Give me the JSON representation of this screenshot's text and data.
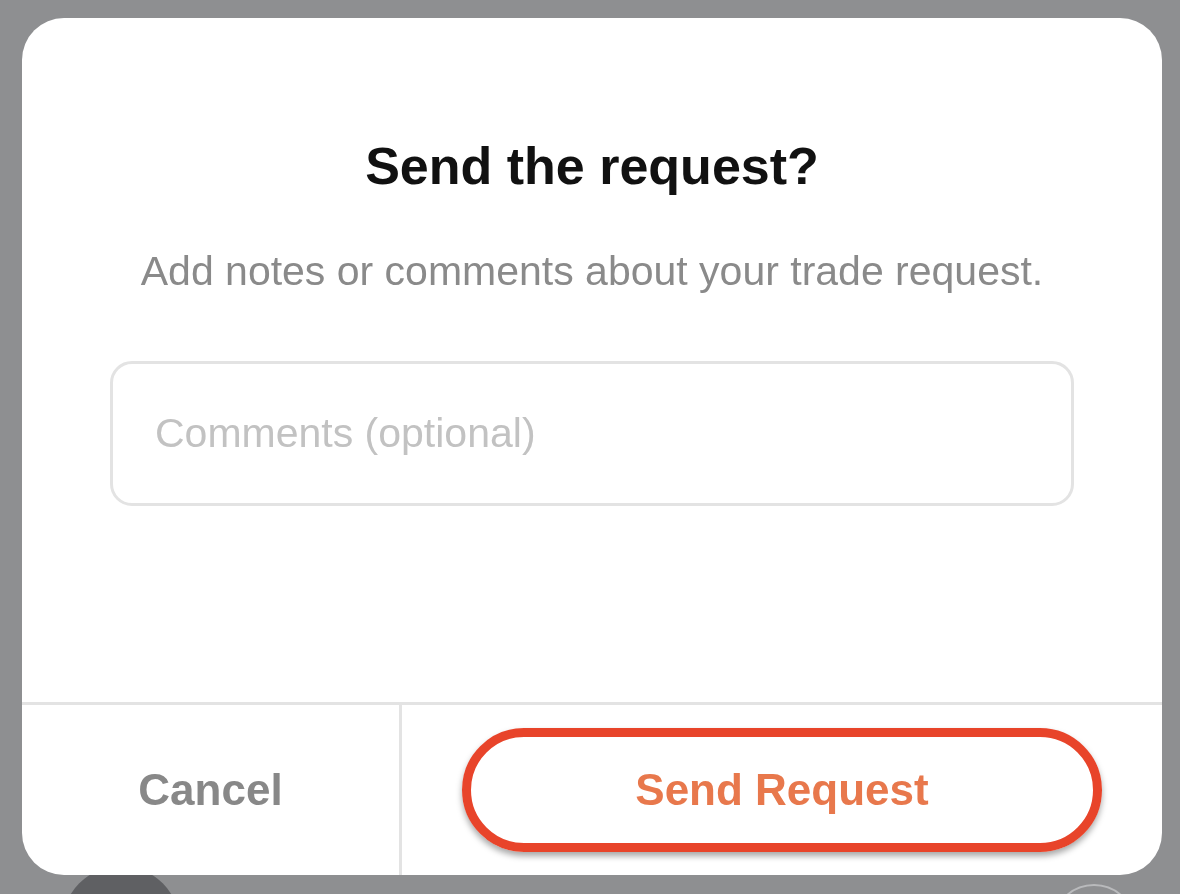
{
  "dialog": {
    "title": "Send the request?",
    "message": "Add notes or comments about your trade request.",
    "comment_field": {
      "placeholder": "Comments (optional)"
    },
    "buttons": [
      {
        "label": "Cancel",
        "kind": "secondary",
        "highlighted": false
      },
      {
        "label": "Send Request",
        "kind": "primary",
        "highlighted": true
      }
    ]
  }
}
